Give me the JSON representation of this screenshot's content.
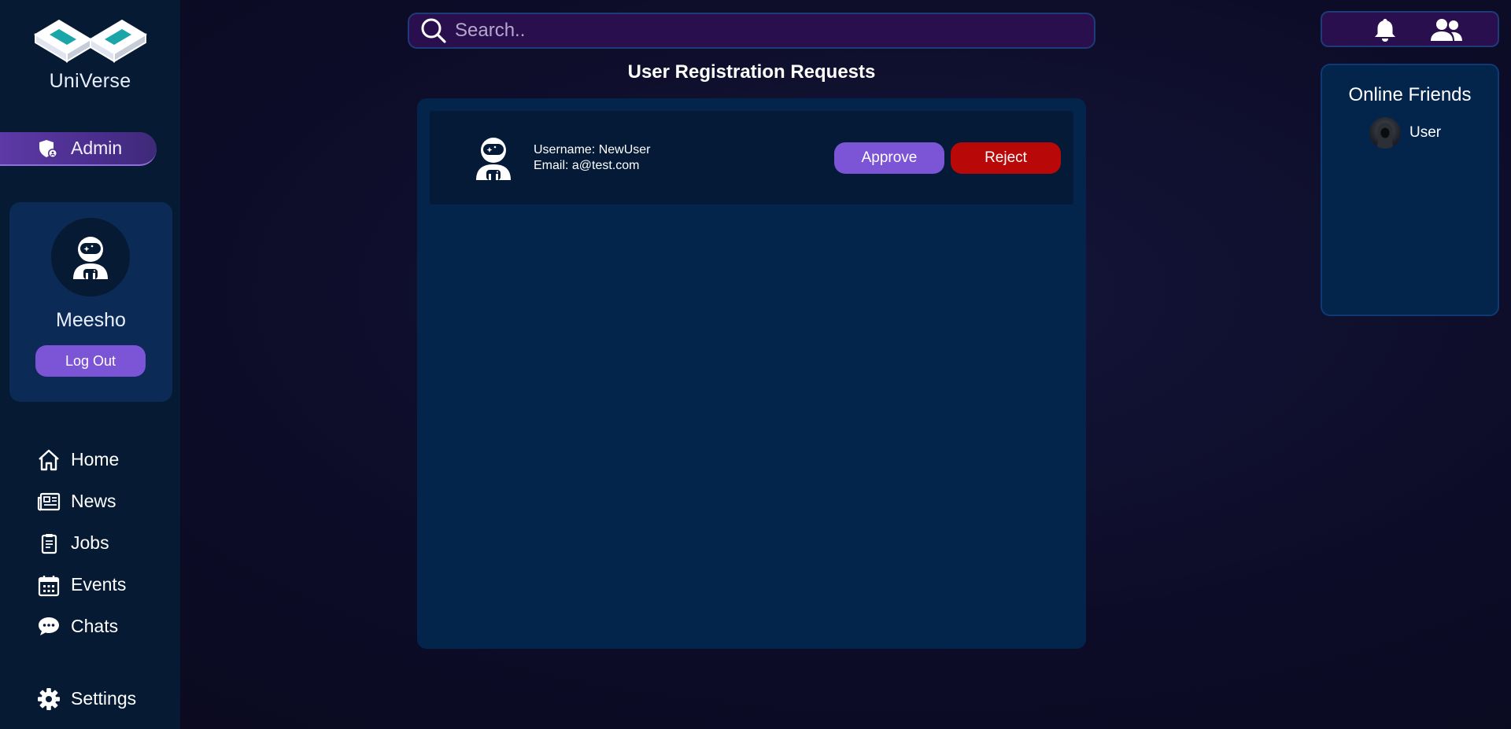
{
  "app": {
    "name": "UniVerse"
  },
  "sidebar": {
    "role_label": "Admin",
    "profile": {
      "name": "Meesho",
      "logout_label": "Log Out"
    },
    "nav": [
      {
        "label": "Home",
        "icon": "home-icon"
      },
      {
        "label": "News",
        "icon": "newspaper-icon"
      },
      {
        "label": "Jobs",
        "icon": "clipboard-icon"
      },
      {
        "label": "Events",
        "icon": "calendar-icon"
      },
      {
        "label": "Chats",
        "icon": "chat-icon"
      }
    ],
    "settings_label": "Settings"
  },
  "search": {
    "placeholder": "Search.."
  },
  "main": {
    "title": "User Registration Requests",
    "requests": [
      {
        "username_line": "Username: NewUser",
        "email_line": "Email: a@test.com",
        "approve_label": "Approve",
        "reject_label": "Reject"
      }
    ]
  },
  "friends": {
    "title": "Online Friends",
    "items": [
      {
        "name": "User"
      }
    ]
  },
  "colors": {
    "accent_purple": "#7b55d6",
    "reject_red": "#b90808",
    "panel_blue": "#03244b",
    "sidebar_bg": "#061a33"
  }
}
